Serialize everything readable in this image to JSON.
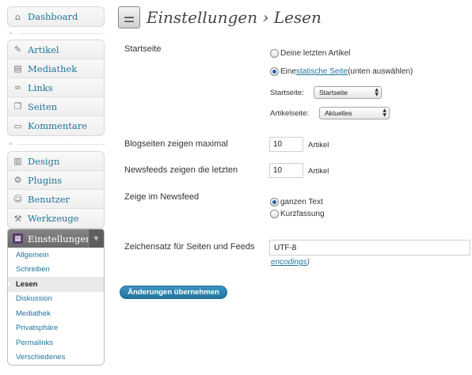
{
  "sidebar": {
    "group1": [
      {
        "label": "Dashboard",
        "icon": "dashboard-icon",
        "glyph": "⌂"
      }
    ],
    "group2": [
      {
        "label": "Artikel",
        "icon": "pushpin-icon",
        "glyph": "✎"
      },
      {
        "label": "Mediathek",
        "icon": "media-icon",
        "glyph": "▤"
      },
      {
        "label": "Links",
        "icon": "links-icon",
        "glyph": "∞"
      },
      {
        "label": "Seiten",
        "icon": "pages-icon",
        "glyph": "❐"
      },
      {
        "label": "Kommentare",
        "icon": "comments-icon",
        "glyph": "▭"
      }
    ],
    "group3": [
      {
        "label": "Design",
        "icon": "appearance-icon",
        "glyph": "▥"
      },
      {
        "label": "Plugins",
        "icon": "plugins-icon",
        "glyph": "⚙"
      },
      {
        "label": "Benutzer",
        "icon": "users-icon",
        "glyph": "☺"
      },
      {
        "label": "Werkzeuge",
        "icon": "tools-icon",
        "glyph": "⚒"
      }
    ],
    "separator_glyph": "«",
    "active": {
      "label": "Einstellungen",
      "icon": "settings-icon",
      "glyph": "▦",
      "toggle_glyph": "▼",
      "submenu": [
        {
          "label": "Allgemein",
          "current": false
        },
        {
          "label": "Schreiben",
          "current": false
        },
        {
          "label": "Lesen",
          "current": true
        },
        {
          "label": "Diskussion",
          "current": false
        },
        {
          "label": "Mediathek",
          "current": false
        },
        {
          "label": "Privatsphäre",
          "current": false
        },
        {
          "label": "Permalinks",
          "current": false
        },
        {
          "label": "Verschiedenes",
          "current": false
        }
      ]
    }
  },
  "header": {
    "title": "Einstellungen › Lesen",
    "icon": "settings-page-icon",
    "glyph": "⚌"
  },
  "form": {
    "startseite": {
      "label": "Startseite",
      "option_latest": "Deine letzten Artikel",
      "option_static_prefix": "Eine ",
      "option_static_link": "statische Seite",
      "option_static_suffix": " (unten auswählen)",
      "selected": "static",
      "front_label": "Startseite:",
      "front_value": "Startseite",
      "posts_label": "Artikelseite:",
      "posts_value": "Aktuelles"
    },
    "blog_pages": {
      "label": "Blogseiten zeigen maximal",
      "value": "10",
      "unit": "Artikel"
    },
    "feeds": {
      "label": "Newsfeeds zeigen die letzten",
      "value": "10",
      "unit": "Artikel"
    },
    "feed_content": {
      "label": "Zeige im Newsfeed",
      "option_full": "ganzen Text",
      "option_summary": "Kurzfassung",
      "selected": "full"
    },
    "charset": {
      "label": "Zeichensatz für Seiten und Feeds",
      "value": "UTF-8",
      "hint_link": "encodings",
      "hint_suffix": ")"
    },
    "submit_label": "Änderungen übernehmen"
  },
  "colors": {
    "accent": "#21759b",
    "active_menu": "#777777"
  }
}
